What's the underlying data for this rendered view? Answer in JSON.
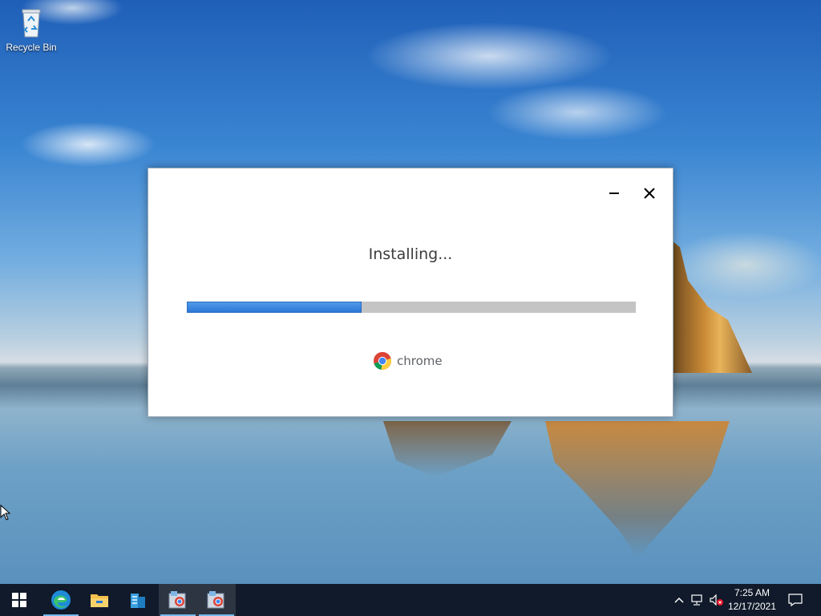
{
  "desktop": {
    "icons": [
      {
        "label": "Recycle Bin",
        "icon": "recycle-bin-icon"
      }
    ]
  },
  "installer": {
    "status": "Installing...",
    "progress_fraction": 0.39,
    "brand_name": "chrome",
    "accent_color": "#2b78d6",
    "buttons": {
      "minimize": "minimize-icon",
      "close": "close-icon"
    }
  },
  "taskbar": {
    "items": [
      {
        "icon": "windows-start-icon"
      },
      {
        "icon": "edge-browser-icon"
      },
      {
        "icon": "file-explorer-icon"
      },
      {
        "icon": "server-manager-icon"
      },
      {
        "icon": "installer-app-icon"
      },
      {
        "icon": "installer-app-icon"
      }
    ],
    "tray": {
      "time": "7:25 AM",
      "date": "12/17/2021",
      "icons": [
        "chevron-up-icon",
        "network-icon",
        "volume-muted-icon",
        "notifications-icon"
      ]
    }
  }
}
